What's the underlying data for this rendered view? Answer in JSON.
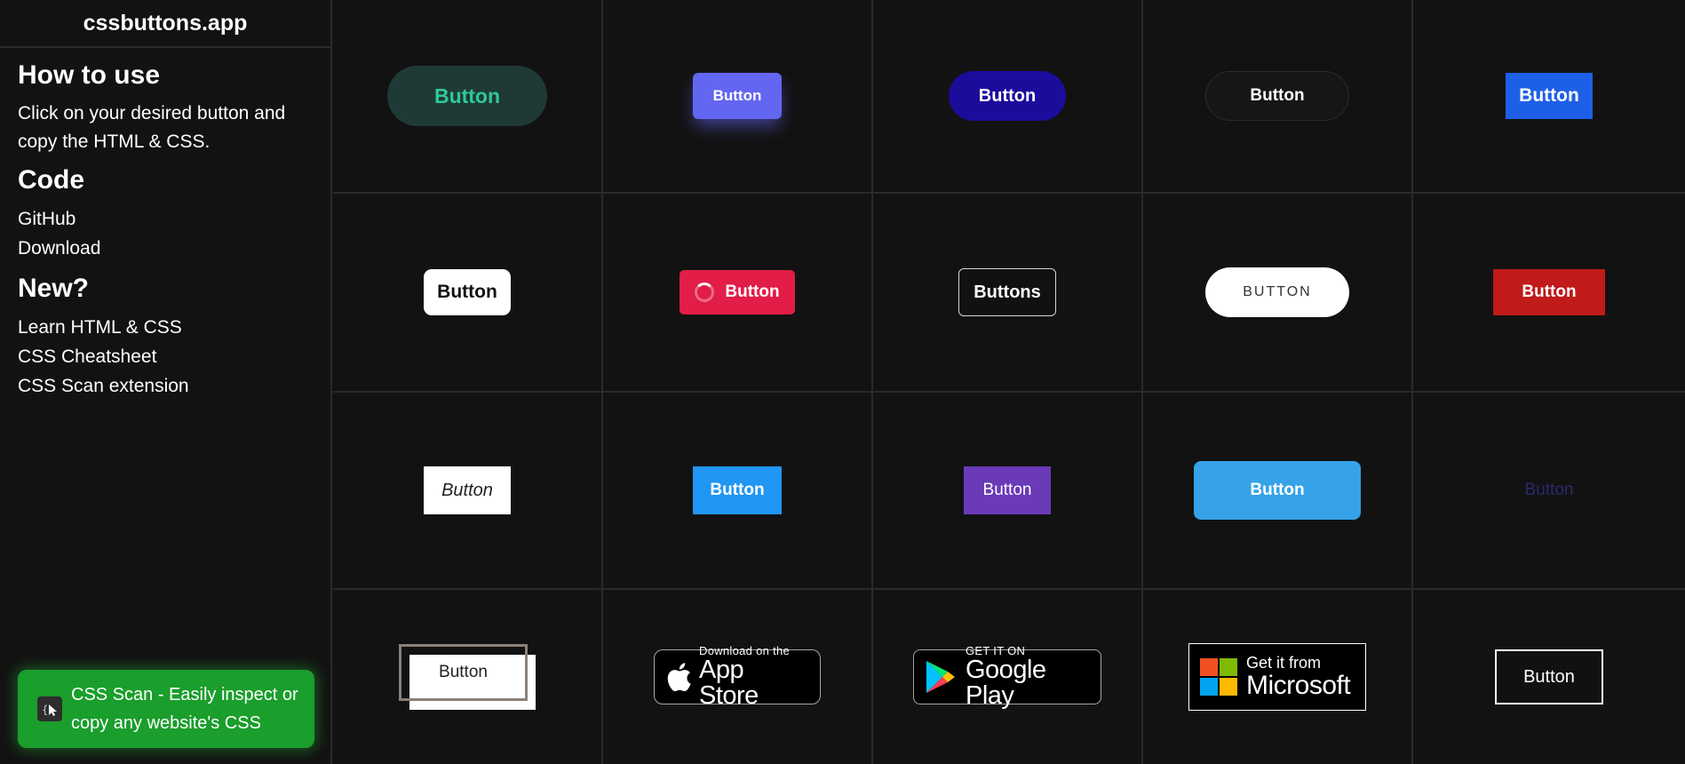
{
  "brand": "cssbuttons.app",
  "sidebar": {
    "how_heading": "How to use",
    "how_text": "Click on your desired button and copy the HTML & CSS.",
    "code_heading": "Code",
    "code_links": [
      "GitHub",
      "Download"
    ],
    "new_heading": "New?",
    "new_links": [
      "Learn HTML & CSS",
      "CSS Cheatsheet",
      "CSS Scan extension"
    ],
    "promo": "CSS Scan - Easily inspect or copy any website's CSS"
  },
  "buttons": {
    "r1": [
      "Button",
      "Button",
      "Button",
      "Button",
      "Button"
    ],
    "r2": [
      "Button",
      "Button",
      "Buttons",
      "BUTTON",
      "Button"
    ],
    "r3": [
      "Button",
      "Button",
      "Button",
      "Button",
      "Button"
    ],
    "r4_first": "Button",
    "r4_last": "Button"
  },
  "stores": {
    "apple_small": "Download on the",
    "apple_big": "App Store",
    "google_small": "GET IT ON",
    "google_big": "Google Play",
    "ms_small": "Get it from",
    "ms_big": "Microsoft"
  },
  "colors": {
    "bg": "#121212",
    "promo": "#1a9e2c"
  }
}
